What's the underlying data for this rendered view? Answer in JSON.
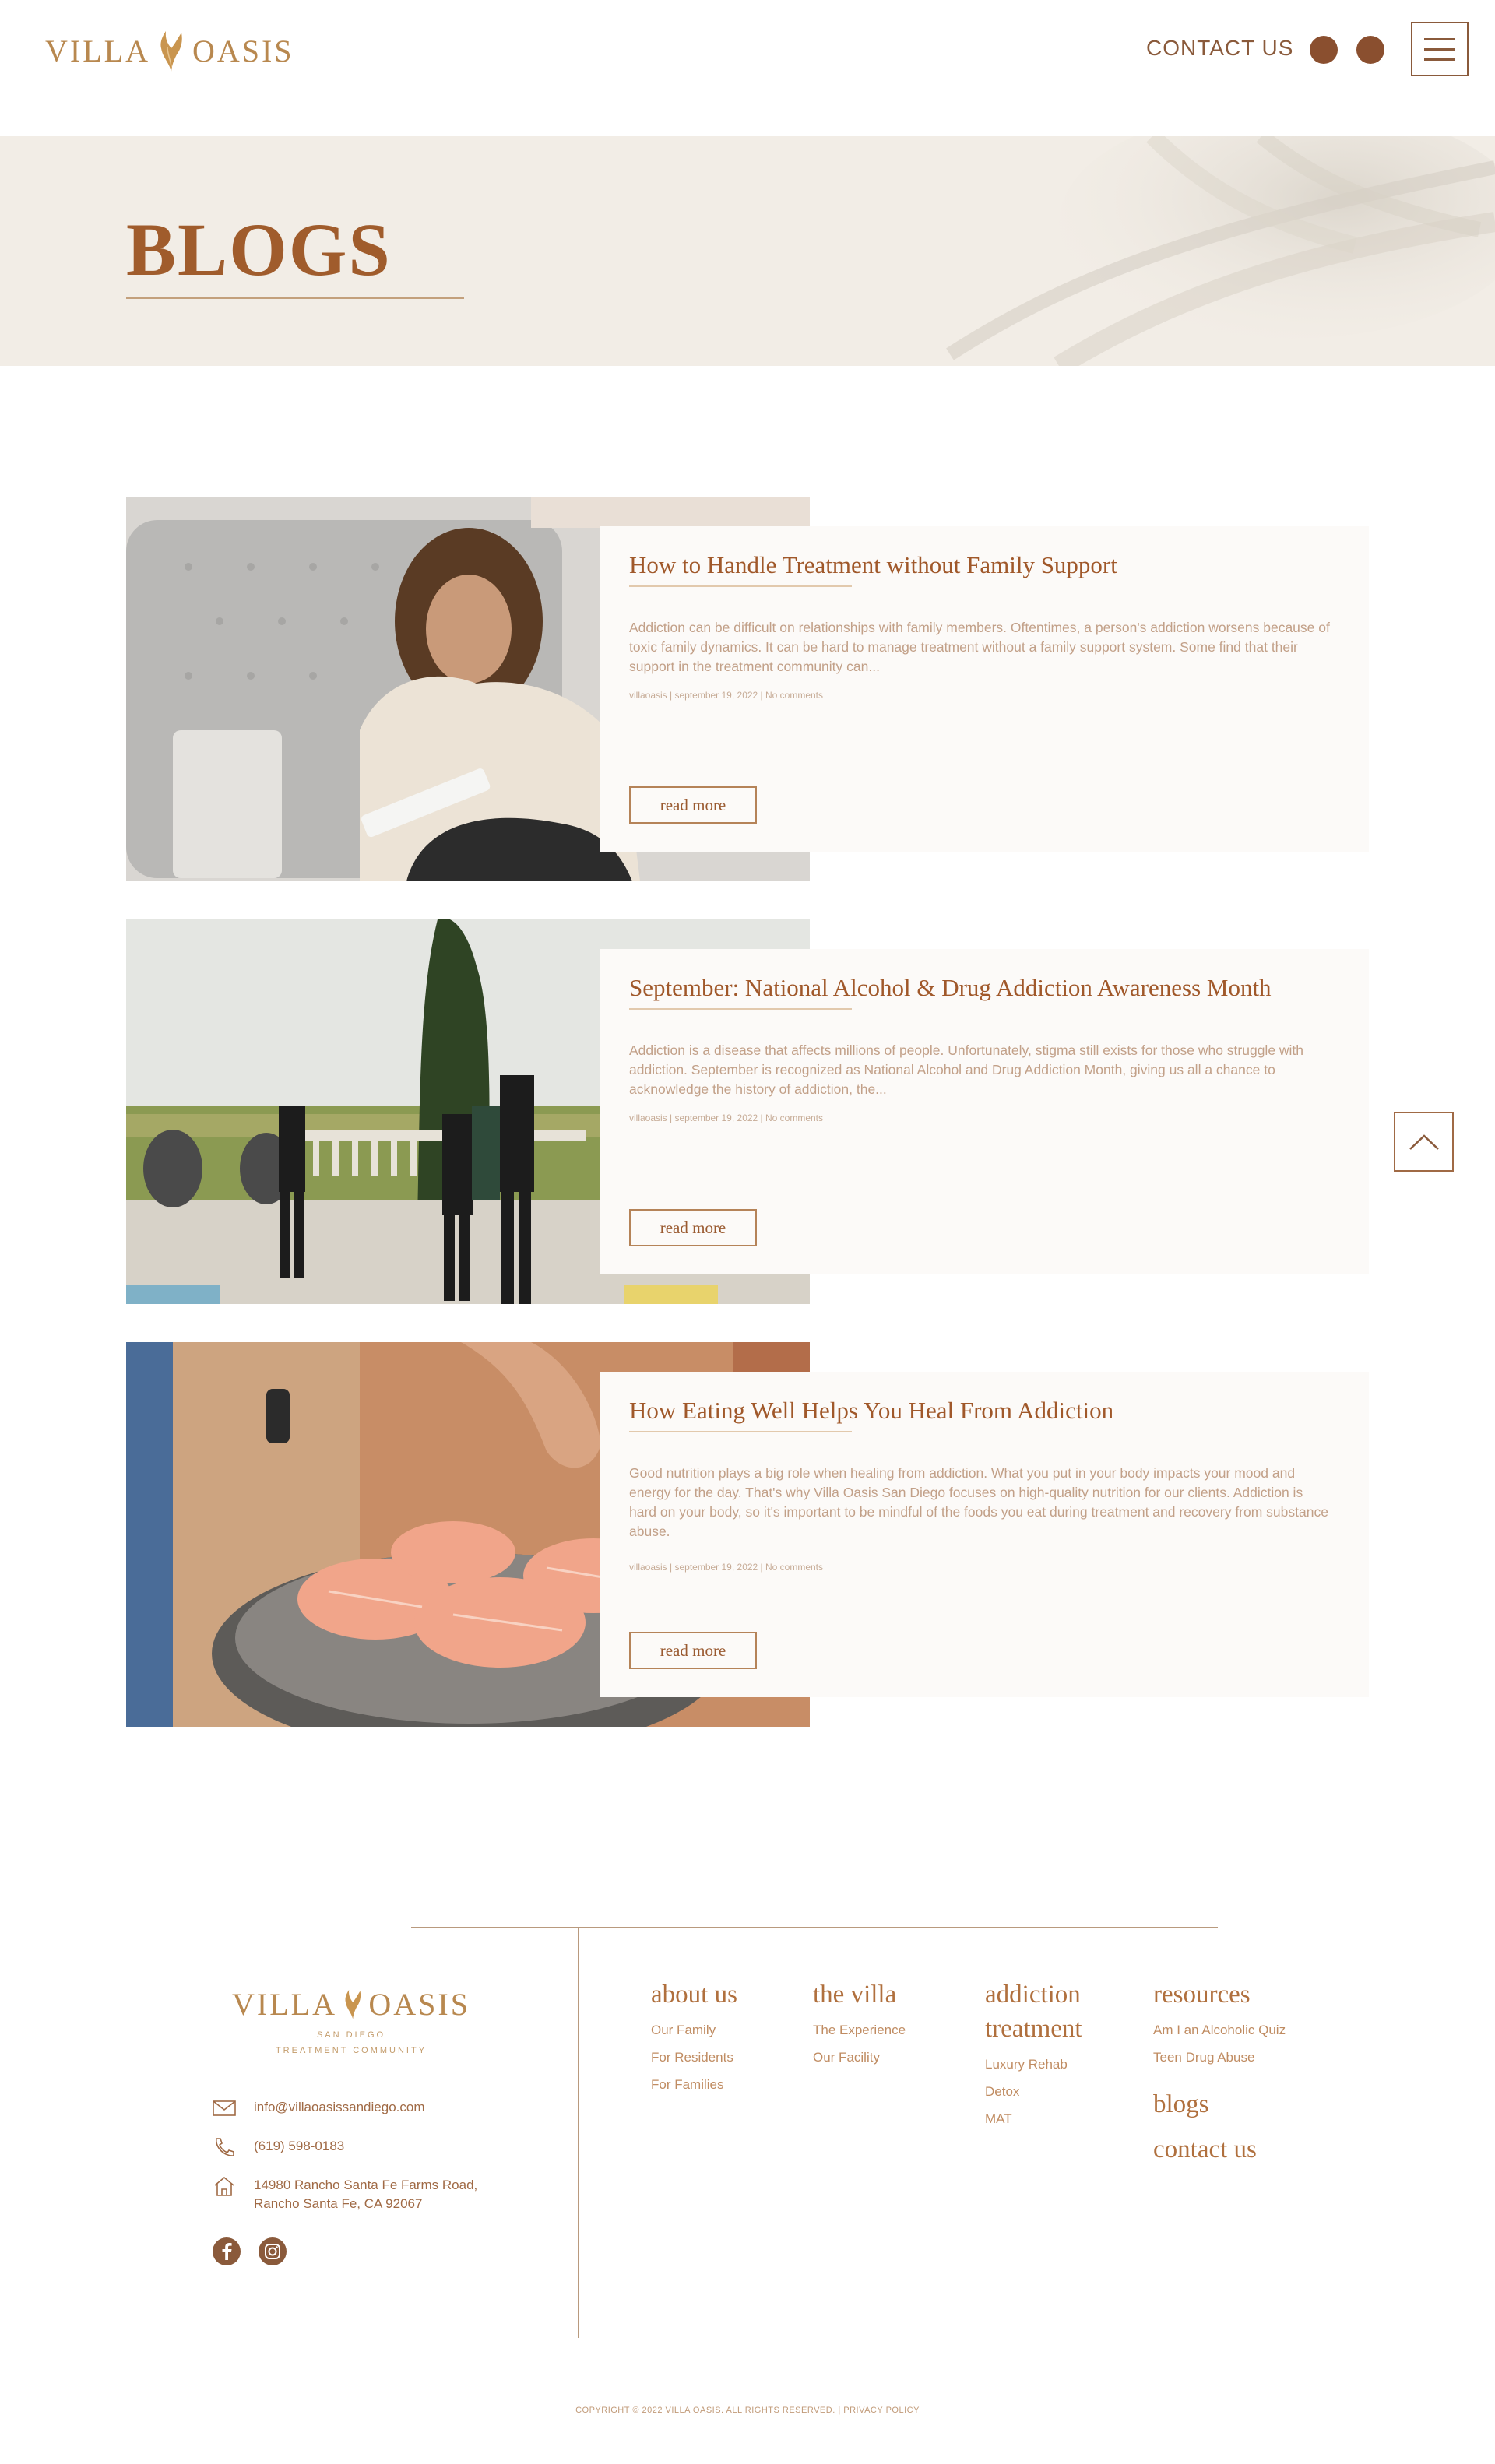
{
  "header": {
    "logo_left": "VILLA",
    "logo_right": "OASIS",
    "contact_label": "CONTACT US"
  },
  "hero": {
    "title": "BLOGS"
  },
  "posts": [
    {
      "title": "How to Handle Treatment without Family Support",
      "excerpt": "Addiction can be difficult on relationships with family members. Oftentimes, a person's addiction worsens because of toxic family dynamics. It can be hard to manage treatment without a family support system. Some find that their support in the treatment community can...",
      "meta": "villaoasis  |  september 19, 2022  |  No comments",
      "read_more": "read more"
    },
    {
      "title": "September: National Alcohol & Drug Addiction Awareness Month",
      "excerpt": "Addiction is a disease that affects millions of people. Unfortunately, stigma still exists for those who struggle with addiction. September is recognized as National Alcohol and Drug Addiction Month, giving us all a chance to acknowledge the history of addiction, the...",
      "meta": "villaoasis  |  september 19, 2022  |  No comments",
      "read_more": "read more"
    },
    {
      "title": "How Eating Well Helps You Heal From Addiction",
      "excerpt": "Good nutrition plays a big role when healing from addiction. What you put in your body impacts your mood and energy for the day. That's why Villa Oasis San Diego focuses on high-quality nutrition for our clients. Addiction is hard on your body, so it's important to be mindful of the foods you eat during treatment and recovery from substance abuse.",
      "meta": "villaoasis  |  september 19, 2022  |  No comments",
      "read_more": "read more"
    }
  ],
  "footer": {
    "logo_left": "VILLA",
    "logo_right": "OASIS",
    "logo_sub1": "SAN DIEGO",
    "logo_sub2": "TREATMENT COMMUNITY",
    "email": "info@villaoasissandiego.com",
    "phone": "(619) 598-0183",
    "address_line1": "14980 Rancho Santa Fe Farms Road,",
    "address_line2": "Rancho Santa Fe, CA 92067",
    "columns": {
      "about": {
        "head": "about us",
        "links": [
          "Our Family",
          "For Residents",
          "For Families"
        ]
      },
      "villa": {
        "head": "the villa",
        "links": [
          "The Experience",
          "Our Facility"
        ]
      },
      "addiction": {
        "head1": "addiction",
        "head2": "treatment",
        "links": [
          "Luxury Rehab",
          "Detox",
          "MAT"
        ]
      },
      "resources": {
        "head": "resources",
        "links": [
          "Am I an Alcoholic Quiz",
          "Teen Drug Abuse"
        ],
        "blogs": "blogs",
        "contact": "contact us"
      }
    },
    "copyright": "COPYRIGHT © 2022 VILLA OASIS. ALL RIGHTS RESERVED. | PRIVACY POLICY"
  },
  "colors": {
    "brand_brown": "#8a5a3b",
    "accent_gold": "#b8884f",
    "hero_bg": "#f2ede6",
    "card_bg": "#fcfaf8"
  },
  "icons": [
    "wing-logo-icon",
    "menu-icon",
    "chevron-up-icon",
    "mail-icon",
    "phone-icon",
    "home-icon",
    "facebook-icon",
    "instagram-icon"
  ]
}
